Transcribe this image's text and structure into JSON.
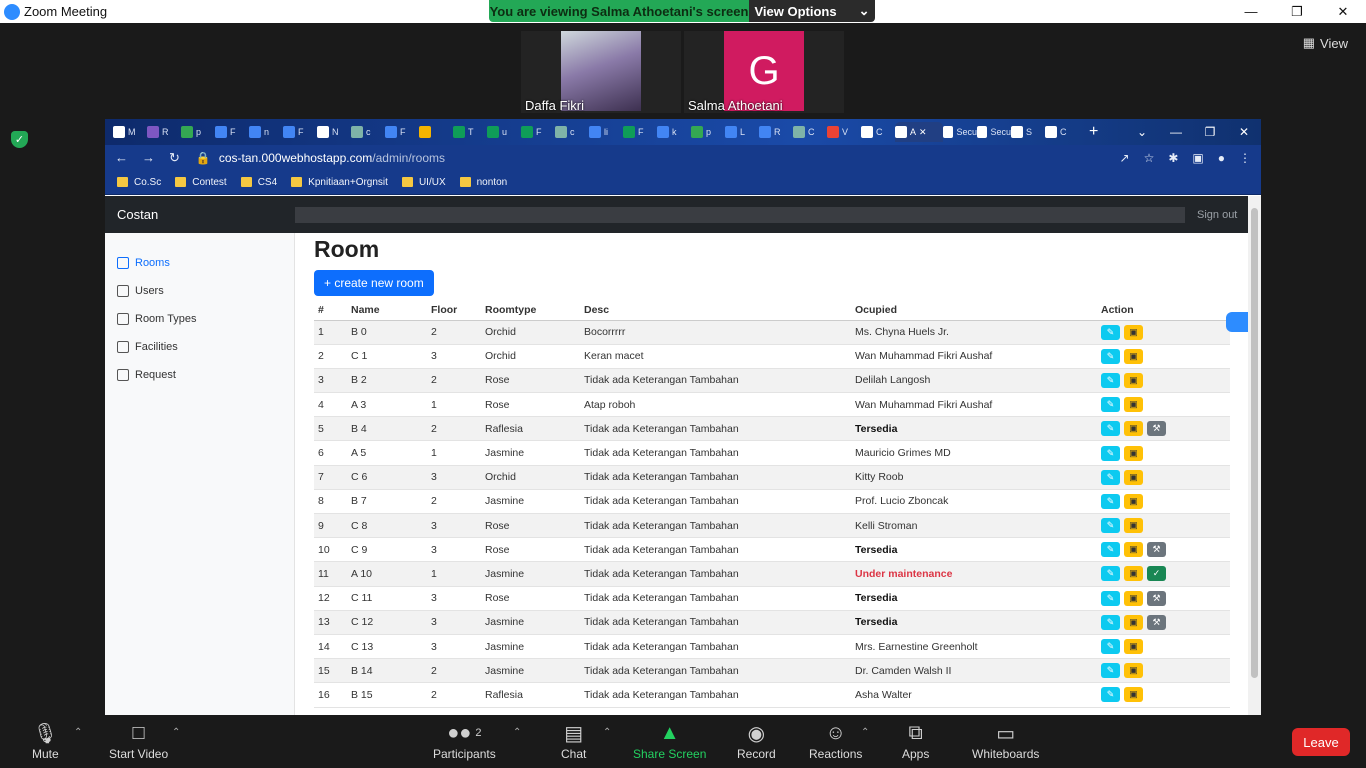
{
  "zoom": {
    "window_title": "Zoom Meeting",
    "banner_text": "You are viewing Salma Athoetani's screen",
    "view_options": "View Options",
    "view_label": "View",
    "participants": [
      {
        "name": "Daffa Fikri"
      },
      {
        "name": "Salma Athoetani",
        "initial": "G"
      }
    ],
    "toolbar": {
      "mute": "Mute",
      "start_video": "Start Video",
      "participants": "Participants",
      "participant_count": "2",
      "chat": "Chat",
      "share_screen": "Share Screen",
      "record": "Record",
      "reactions": "Reactions",
      "apps": "Apps",
      "whiteboards": "Whiteboards",
      "leave": "Leave"
    }
  },
  "browser": {
    "url_host": "cos-tan.000webhostapp.com",
    "url_path": "/admin/rooms",
    "bookmarks": [
      "Co.Sc",
      "Contest",
      "CS4",
      "Kpnitiaan+Orgnsit",
      "UI/UX",
      "nonton"
    ],
    "tabs": [
      "M",
      "R",
      "p",
      "F",
      "n",
      "F",
      "N",
      "c",
      "F",
      "",
      "T",
      "u",
      "F",
      "c",
      "li",
      "F",
      "k",
      "p",
      "L",
      "R",
      "C",
      "V",
      "C",
      "A",
      "Secu",
      "Secu",
      "S",
      "C"
    ]
  },
  "app": {
    "brand": "Costan",
    "sign_out": "Sign out",
    "sidebar": [
      "Rooms",
      "Users",
      "Room Types",
      "Facilities",
      "Request"
    ],
    "page_title": "Room",
    "create_button": "+ create new room",
    "columns": [
      "#",
      "Name",
      "Floor",
      "Roomtype",
      "Desc",
      "Ocupied",
      "Action"
    ],
    "rows": [
      {
        "no": "1",
        "name": "B 0",
        "floor": "2",
        "type": "Orchid",
        "desc": "Bocorrrrr",
        "occupied": "Ms. Chyna Huels Jr.",
        "status": "normal"
      },
      {
        "no": "2",
        "name": "C 1",
        "floor": "3",
        "type": "Orchid",
        "desc": "Keran macet",
        "occupied": "Wan Muhammad Fikri Aushaf",
        "status": "normal"
      },
      {
        "no": "3",
        "name": "B 2",
        "floor": "2",
        "type": "Rose",
        "desc": "Tidak ada Keterangan Tambahan",
        "occupied": "Delilah Langosh",
        "status": "normal"
      },
      {
        "no": "4",
        "name": "A 3",
        "floor": "1",
        "type": "Rose",
        "desc": "Atap roboh",
        "occupied": "Wan Muhammad Fikri Aushaf",
        "status": "normal"
      },
      {
        "no": "5",
        "name": "B 4",
        "floor": "2",
        "type": "Raflesia",
        "desc": "Tidak ada Keterangan Tambahan",
        "occupied": "Tersedia",
        "status": "available"
      },
      {
        "no": "6",
        "name": "A 5",
        "floor": "1",
        "type": "Jasmine",
        "desc": "Tidak ada Keterangan Tambahan",
        "occupied": "Mauricio Grimes MD",
        "status": "normal"
      },
      {
        "no": "7",
        "name": "C 6",
        "floor": "3",
        "type": "Orchid",
        "desc": "Tidak ada Keterangan Tambahan",
        "occupied": "Kitty Roob",
        "status": "normal"
      },
      {
        "no": "8",
        "name": "B 7",
        "floor": "2",
        "type": "Jasmine",
        "desc": "Tidak ada Keterangan Tambahan",
        "occupied": "Prof. Lucio Zboncak",
        "status": "normal"
      },
      {
        "no": "9",
        "name": "C 8",
        "floor": "3",
        "type": "Rose",
        "desc": "Tidak ada Keterangan Tambahan",
        "occupied": "Kelli Stroman",
        "status": "normal"
      },
      {
        "no": "10",
        "name": "C 9",
        "floor": "3",
        "type": "Rose",
        "desc": "Tidak ada Keterangan Tambahan",
        "occupied": "Tersedia",
        "status": "available"
      },
      {
        "no": "11",
        "name": "A 10",
        "floor": "1",
        "type": "Jasmine",
        "desc": "Tidak ada Keterangan Tambahan",
        "occupied": "Under maintenance",
        "status": "maintenance"
      },
      {
        "no": "12",
        "name": "C 11",
        "floor": "3",
        "type": "Rose",
        "desc": "Tidak ada Keterangan Tambahan",
        "occupied": "Tersedia",
        "status": "available"
      },
      {
        "no": "13",
        "name": "C 12",
        "floor": "3",
        "type": "Jasmine",
        "desc": "Tidak ada Keterangan Tambahan",
        "occupied": "Tersedia",
        "status": "available"
      },
      {
        "no": "14",
        "name": "C 13",
        "floor": "3",
        "type": "Jasmine",
        "desc": "Tidak ada Keterangan Tambahan",
        "occupied": "Mrs. Earnestine Greenholt",
        "status": "normal"
      },
      {
        "no": "15",
        "name": "B 14",
        "floor": "2",
        "type": "Jasmine",
        "desc": "Tidak ada Keterangan Tambahan",
        "occupied": "Dr. Camden Walsh II",
        "status": "normal"
      },
      {
        "no": "16",
        "name": "B 15",
        "floor": "2",
        "type": "Raflesia",
        "desc": "Tidak ada Keterangan Tambahan",
        "occupied": "Asha Walter",
        "status": "normal"
      }
    ]
  },
  "colors": {
    "zoom_green": "#23a856",
    "primary": "#0d6efd",
    "danger": "#dc3545",
    "leave": "#e02828"
  }
}
